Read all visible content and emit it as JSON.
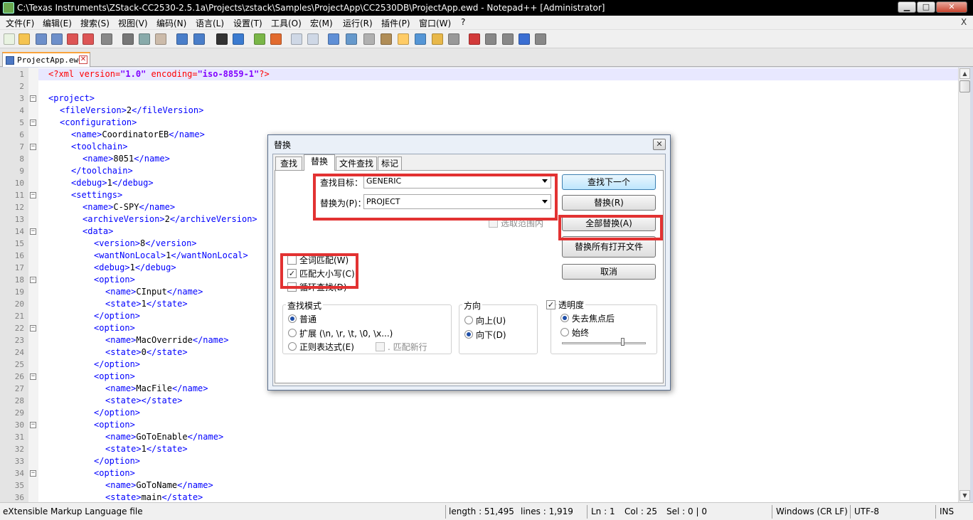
{
  "window": {
    "title": "C:\\Texas Instruments\\ZStack-CC2530-2.5.1a\\Projects\\zstack\\Samples\\ProjectApp\\CC2530DB\\ProjectApp.ewd - Notepad++ [Administrator]",
    "min_label": "▁",
    "max_label": "□",
    "close_label": "✕"
  },
  "menu": {
    "items": [
      "文件(F)",
      "编辑(E)",
      "搜索(S)",
      "视图(V)",
      "编码(N)",
      "语言(L)",
      "设置(T)",
      "工具(O)",
      "宏(M)",
      "运行(R)",
      "插件(P)",
      "窗口(W)",
      "?"
    ],
    "close": "X"
  },
  "toolbar": {
    "icons": [
      "new-file-icon",
      "open-file-icon",
      "save-icon",
      "save-all-icon",
      "close-icon",
      "close-all-icon",
      "print-icon",
      "cut-icon",
      "copy-icon",
      "paste-icon",
      "undo-icon",
      "redo-icon",
      "find-icon",
      "replace-icon",
      "zoom-in-icon",
      "zoom-out-icon",
      "sync-vertical-icon",
      "sync-horizontal-icon",
      "word-wrap-icon",
      "show-all-chars-icon",
      "indent-guide-icon",
      "user-lang-icon",
      "doc-map-icon",
      "function-list-icon",
      "folder-workspace-icon",
      "monitor-icon",
      "record-macro-icon",
      "stop-macro-icon",
      "play-macro-icon",
      "run-macro-multiple-icon",
      "save-macro-icon"
    ],
    "colors": [
      "#e9f3e1",
      "#f5c451",
      "#6d8fca",
      "#6d8fca",
      "#d55",
      "#d55",
      "#888",
      "#777",
      "#8aa",
      "#cba",
      "#4a7ec9",
      "#4a7ec9",
      "#333",
      "#3b7bd0",
      "#7ab648",
      "#e26b2f",
      "#cfd8e6",
      "#cfd8e6",
      "#5f8fd6",
      "#6699cc",
      "#b0b0b0",
      "#b08d57",
      "#ffcc66",
      "#5596d6",
      "#e8b84a",
      "#999",
      "#d23a3a",
      "#888",
      "#888",
      "#3b6ed2",
      "#888"
    ]
  },
  "tab": {
    "file_name": "ProjectApp.ewd",
    "close": "✕"
  },
  "editor": {
    "lines": [
      {
        "n": "1",
        "fold": "",
        "indent": 0,
        "parts": [
          [
            "decl",
            "<?xml "
          ],
          [
            "attr",
            "version"
          ],
          [
            "decl",
            "="
          ],
          [
            "str",
            "\"1.0\""
          ],
          [
            "decl",
            " "
          ],
          [
            "attr",
            "encoding"
          ],
          [
            "decl",
            "="
          ],
          [
            "str",
            "\"iso-8859-1\""
          ],
          [
            "decl",
            "?>"
          ]
        ]
      },
      {
        "n": "2",
        "fold": "",
        "indent": 0,
        "parts": []
      },
      {
        "n": "3",
        "fold": "−",
        "indent": 0,
        "parts": [
          [
            "tag",
            "<project>"
          ]
        ]
      },
      {
        "n": "4",
        "fold": "",
        "indent": 1,
        "parts": [
          [
            "tag",
            "<fileVersion>"
          ],
          [
            "text",
            "2"
          ],
          [
            "tag",
            "</fileVersion>"
          ]
        ]
      },
      {
        "n": "5",
        "fold": "−",
        "indent": 1,
        "parts": [
          [
            "tag",
            "<configuration>"
          ]
        ]
      },
      {
        "n": "6",
        "fold": "",
        "indent": 2,
        "parts": [
          [
            "tag",
            "<name>"
          ],
          [
            "text",
            "CoordinatorEB"
          ],
          [
            "tag",
            "</name>"
          ]
        ]
      },
      {
        "n": "7",
        "fold": "−",
        "indent": 2,
        "parts": [
          [
            "tag",
            "<toolchain>"
          ]
        ]
      },
      {
        "n": "8",
        "fold": "",
        "indent": 3,
        "parts": [
          [
            "tag",
            "<name>"
          ],
          [
            "text",
            "8051"
          ],
          [
            "tag",
            "</name>"
          ]
        ]
      },
      {
        "n": "9",
        "fold": "",
        "indent": 2,
        "parts": [
          [
            "tag",
            "</toolchain>"
          ]
        ]
      },
      {
        "n": "10",
        "fold": "",
        "indent": 2,
        "parts": [
          [
            "tag",
            "<debug>"
          ],
          [
            "text",
            "1"
          ],
          [
            "tag",
            "</debug>"
          ]
        ]
      },
      {
        "n": "11",
        "fold": "−",
        "indent": 2,
        "parts": [
          [
            "tag",
            "<settings>"
          ]
        ]
      },
      {
        "n": "12",
        "fold": "",
        "indent": 3,
        "parts": [
          [
            "tag",
            "<name>"
          ],
          [
            "text",
            "C-SPY"
          ],
          [
            "tag",
            "</name>"
          ]
        ]
      },
      {
        "n": "13",
        "fold": "",
        "indent": 3,
        "parts": [
          [
            "tag",
            "<archiveVersion>"
          ],
          [
            "text",
            "2"
          ],
          [
            "tag",
            "</archiveVersion>"
          ]
        ]
      },
      {
        "n": "14",
        "fold": "−",
        "indent": 3,
        "parts": [
          [
            "tag",
            "<data>"
          ]
        ]
      },
      {
        "n": "15",
        "fold": "",
        "indent": 4,
        "parts": [
          [
            "tag",
            "<version>"
          ],
          [
            "text",
            "8"
          ],
          [
            "tag",
            "</version>"
          ]
        ]
      },
      {
        "n": "16",
        "fold": "",
        "indent": 4,
        "parts": [
          [
            "tag",
            "<wantNonLocal>"
          ],
          [
            "text",
            "1"
          ],
          [
            "tag",
            "</wantNonLocal>"
          ]
        ]
      },
      {
        "n": "17",
        "fold": "",
        "indent": 4,
        "parts": [
          [
            "tag",
            "<debug>"
          ],
          [
            "text",
            "1"
          ],
          [
            "tag",
            "</debug>"
          ]
        ]
      },
      {
        "n": "18",
        "fold": "−",
        "indent": 4,
        "parts": [
          [
            "tag",
            "<option>"
          ]
        ]
      },
      {
        "n": "19",
        "fold": "",
        "indent": 5,
        "parts": [
          [
            "tag",
            "<name>"
          ],
          [
            "text",
            "CInput"
          ],
          [
            "tag",
            "</name>"
          ]
        ]
      },
      {
        "n": "20",
        "fold": "",
        "indent": 5,
        "parts": [
          [
            "tag",
            "<state>"
          ],
          [
            "text",
            "1"
          ],
          [
            "tag",
            "</state>"
          ]
        ]
      },
      {
        "n": "21",
        "fold": "",
        "indent": 4,
        "parts": [
          [
            "tag",
            "</option>"
          ]
        ]
      },
      {
        "n": "22",
        "fold": "−",
        "indent": 4,
        "parts": [
          [
            "tag",
            "<option>"
          ]
        ]
      },
      {
        "n": "23",
        "fold": "",
        "indent": 5,
        "parts": [
          [
            "tag",
            "<name>"
          ],
          [
            "text",
            "MacOverride"
          ],
          [
            "tag",
            "</name>"
          ]
        ]
      },
      {
        "n": "24",
        "fold": "",
        "indent": 5,
        "parts": [
          [
            "tag",
            "<state>"
          ],
          [
            "text",
            "0"
          ],
          [
            "tag",
            "</state>"
          ]
        ]
      },
      {
        "n": "25",
        "fold": "",
        "indent": 4,
        "parts": [
          [
            "tag",
            "</option>"
          ]
        ]
      },
      {
        "n": "26",
        "fold": "−",
        "indent": 4,
        "parts": [
          [
            "tag",
            "<option>"
          ]
        ]
      },
      {
        "n": "27",
        "fold": "",
        "indent": 5,
        "parts": [
          [
            "tag",
            "<name>"
          ],
          [
            "text",
            "MacFile"
          ],
          [
            "tag",
            "</name>"
          ]
        ]
      },
      {
        "n": "28",
        "fold": "",
        "indent": 5,
        "parts": [
          [
            "tag",
            "<state></state>"
          ]
        ]
      },
      {
        "n": "29",
        "fold": "",
        "indent": 4,
        "parts": [
          [
            "tag",
            "</option>"
          ]
        ]
      },
      {
        "n": "30",
        "fold": "−",
        "indent": 4,
        "parts": [
          [
            "tag",
            "<option>"
          ]
        ]
      },
      {
        "n": "31",
        "fold": "",
        "indent": 5,
        "parts": [
          [
            "tag",
            "<name>"
          ],
          [
            "text",
            "GoToEnable"
          ],
          [
            "tag",
            "</name>"
          ]
        ]
      },
      {
        "n": "32",
        "fold": "",
        "indent": 5,
        "parts": [
          [
            "tag",
            "<state>"
          ],
          [
            "text",
            "1"
          ],
          [
            "tag",
            "</state>"
          ]
        ]
      },
      {
        "n": "33",
        "fold": "",
        "indent": 4,
        "parts": [
          [
            "tag",
            "</option>"
          ]
        ]
      },
      {
        "n": "34",
        "fold": "−",
        "indent": 4,
        "parts": [
          [
            "tag",
            "<option>"
          ]
        ]
      },
      {
        "n": "35",
        "fold": "",
        "indent": 5,
        "parts": [
          [
            "tag",
            "<name>"
          ],
          [
            "text",
            "GoToName"
          ],
          [
            "tag",
            "</name>"
          ]
        ]
      },
      {
        "n": "36",
        "fold": "",
        "indent": 5,
        "parts": [
          [
            "tag",
            "<state>"
          ],
          [
            "text",
            "main"
          ],
          [
            "tag",
            "</state>"
          ]
        ]
      }
    ]
  },
  "scrollbar": {
    "up": "▲",
    "down": "▼"
  },
  "status": {
    "filetype": "eXtensible Markup Language file",
    "length": "length : 51,495",
    "lines": "lines : 1,919",
    "ln": "Ln : 1",
    "col": "Col : 25",
    "sel": "Sel : 0 | 0",
    "eol": "Windows (CR LF)",
    "encoding": "UTF-8",
    "mode": "INS"
  },
  "dialog": {
    "title": "替换",
    "close": "✕",
    "tabs": [
      "查找",
      "替换",
      "文件查找",
      "标记"
    ],
    "find_label": "查找目标：",
    "find_value": "GENERIC",
    "replace_label": "替换为(P)：",
    "replace_value": "PROJECT",
    "in_selection": "选取范围内",
    "buttons": {
      "find_next": "查找下一个",
      "replace": "替换(R)",
      "replace_all": "全部替换(A)",
      "replace_all_open": "替换所有打开文件",
      "cancel": "取消"
    },
    "options": {
      "whole_word": "全词匹配(W)",
      "whole_word_checked": false,
      "match_case": "匹配大小写(C)",
      "match_case_checked": true,
      "wrap_around": "循环查找(D)",
      "wrap_around_checked": false
    },
    "search_mode": {
      "title": "查找模式",
      "normal": "普通",
      "extended": "扩展 (\\n, \\r, \\t, \\0, \\x...)",
      "regex": "正则表达式(E)",
      "dot_newline": ". 匹配新行",
      "selected": "normal"
    },
    "direction": {
      "title": "方向",
      "up": "向上(U)",
      "down": "向下(D)",
      "selected": "down"
    },
    "transparency": {
      "title": "透明度",
      "checked": true,
      "on_lose_focus": "失去焦点后",
      "always": "始终",
      "selected": "on_lose_focus",
      "level": 0.72
    },
    "check_mark": "✓",
    "highlight_color": "#e23232"
  }
}
